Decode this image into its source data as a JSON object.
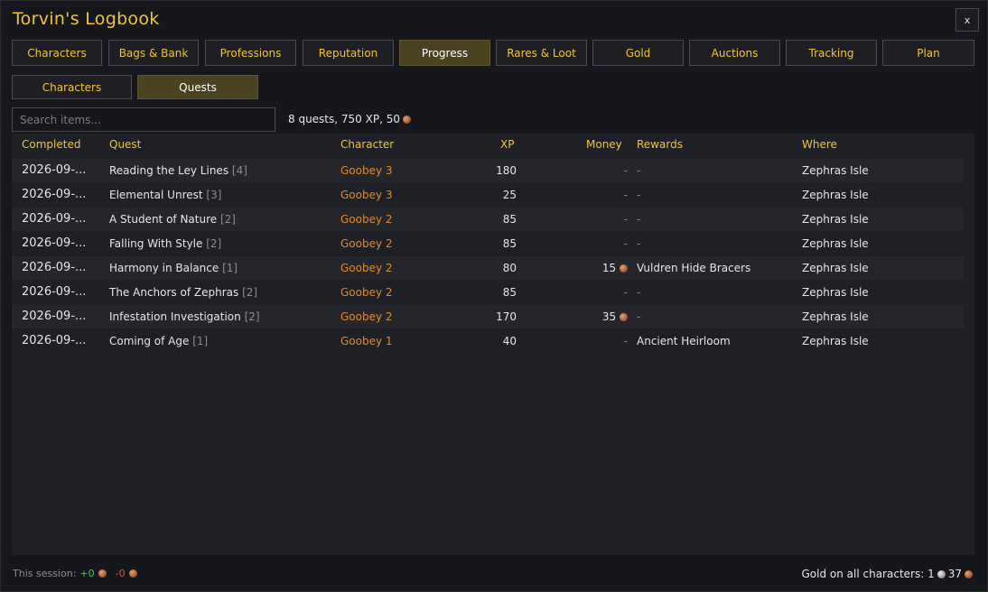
{
  "window": {
    "title": "Torvin's Logbook",
    "close_label": "x"
  },
  "tabs": [
    {
      "label": "Characters",
      "active": false
    },
    {
      "label": "Bags & Bank",
      "active": false
    },
    {
      "label": "Professions",
      "active": false
    },
    {
      "label": "Reputation",
      "active": false
    },
    {
      "label": "Progress",
      "active": true
    },
    {
      "label": "Rares & Loot",
      "active": false
    },
    {
      "label": "Gold",
      "active": false
    },
    {
      "label": "Auctions",
      "active": false
    },
    {
      "label": "Tracking",
      "active": false
    },
    {
      "label": "Plan",
      "active": false
    }
  ],
  "subtabs": [
    {
      "label": "Characters",
      "active": false
    },
    {
      "label": "Quests",
      "active": true
    }
  ],
  "search": {
    "placeholder": "Search items...",
    "value": ""
  },
  "summary": {
    "text": "8 quests, 750 XP, 50"
  },
  "table": {
    "headers": {
      "completed": "Completed",
      "quest": "Quest",
      "character": "Character",
      "xp": "XP",
      "money": "Money",
      "rewards": "Rewards",
      "where": "Where"
    },
    "rows": [
      {
        "completed": "2026-09-...",
        "quest": "Reading the Ley Lines",
        "rank": "[4]",
        "character": "Goobey 3",
        "xp": "180",
        "money": "-",
        "money_coin": false,
        "rewards": "-",
        "where": "Zephras Isle"
      },
      {
        "completed": "2026-09-...",
        "quest": "Elemental Unrest",
        "rank": "[3]",
        "character": "Goobey 3",
        "xp": "25",
        "money": "-",
        "money_coin": false,
        "rewards": "-",
        "where": "Zephras Isle"
      },
      {
        "completed": "2026-09-...",
        "quest": "A Student of Nature",
        "rank": "[2]",
        "character": "Goobey 2",
        "xp": "85",
        "money": "-",
        "money_coin": false,
        "rewards": "-",
        "where": "Zephras Isle"
      },
      {
        "completed": "2026-09-...",
        "quest": "Falling With Style",
        "rank": "[2]",
        "character": "Goobey 2",
        "xp": "85",
        "money": "-",
        "money_coin": false,
        "rewards": "-",
        "where": "Zephras Isle"
      },
      {
        "completed": "2026-09-...",
        "quest": "Harmony in Balance",
        "rank": "[1]",
        "character": "Goobey 2",
        "xp": "80",
        "money": "15",
        "money_coin": true,
        "rewards": "Vuldren Hide Bracers",
        "where": "Zephras Isle"
      },
      {
        "completed": "2026-09-...",
        "quest": "The Anchors of Zephras",
        "rank": "[2]",
        "character": "Goobey 2",
        "xp": "85",
        "money": "-",
        "money_coin": false,
        "rewards": "-",
        "where": "Zephras Isle"
      },
      {
        "completed": "2026-09-...",
        "quest": "Infestation Investigation",
        "rank": "[2]",
        "character": "Goobey 2",
        "xp": "170",
        "money": "35",
        "money_coin": true,
        "rewards": "-",
        "where": "Zephras Isle"
      },
      {
        "completed": "2026-09-...",
        "quest": "Coming of Age",
        "rank": "[1]",
        "character": "Goobey 1",
        "xp": "40",
        "money": "-",
        "money_coin": false,
        "rewards": "Ancient Heirloom",
        "where": "Zephras Isle"
      }
    ]
  },
  "footer": {
    "session_label": "This session:",
    "session_plus": "+0",
    "session_minus": "-0",
    "gold_label": "Gold on all characters: 1",
    "gold_silver": "37"
  },
  "colors": {
    "accent_gold": "#f0c43a",
    "character_orange": "#e08a2e",
    "active_tab": "#4a4220",
    "positive": "#3ed43e",
    "negative": "#e05050"
  },
  "icons": {
    "copper": "copper-coin-icon",
    "silver": "silver-coin-icon"
  }
}
